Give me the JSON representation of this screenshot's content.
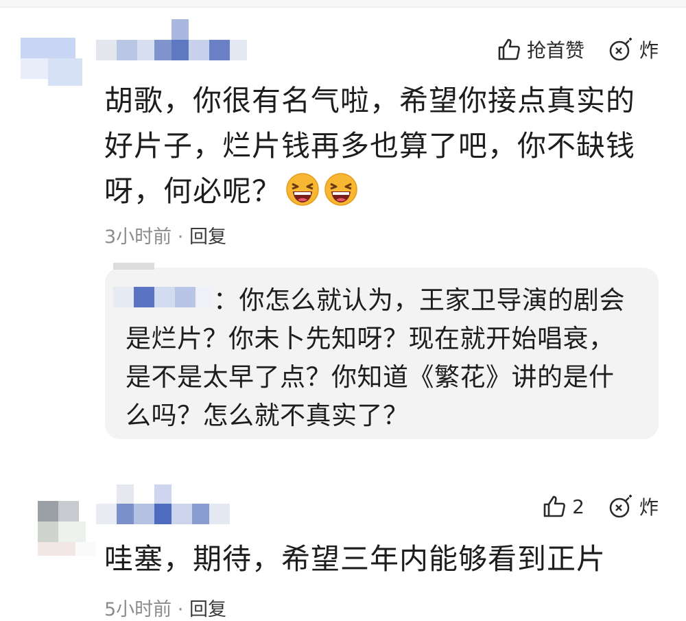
{
  "comments": [
    {
      "text_line1": "胡歌，你很有名气啦，希望你接点真实的",
      "text_line2": "好片子，烂片钱再多也算了吧，你不缺钱",
      "text_line3": "呀，何必呢？",
      "emoji": [
        "laughing-emoji",
        "laughing-emoji"
      ],
      "time": "3小时前",
      "separator": "·",
      "reply_label": "回复",
      "like_label": "抢首赞",
      "bomb_label": "炸",
      "reply": {
        "text_line1": "：你怎么就认为，王家卫导演的剧会",
        "text_line2": "是烂片？你未卜先知呀？现在就开始唱衰，",
        "text_line3": "是不是太早了点？你知道《繁花》讲的是什",
        "text_line4": "么吗？怎么就不真实了？"
      }
    },
    {
      "text_line1": "哇塞，期待，希望三年内能够看到正片",
      "time": "5小时前",
      "separator": "·",
      "reply_label": "回复",
      "like_count": "2",
      "bomb_label": "炸"
    }
  ],
  "colors": {
    "text": "#1d1d1d",
    "meta": "#8c8c8c",
    "reply_bg": "#f3f3f3",
    "mosaic_blue": "#4f6fbf"
  },
  "icons": [
    "thumbs-up-icon",
    "bomb-icon",
    "laughing-emoji"
  ]
}
